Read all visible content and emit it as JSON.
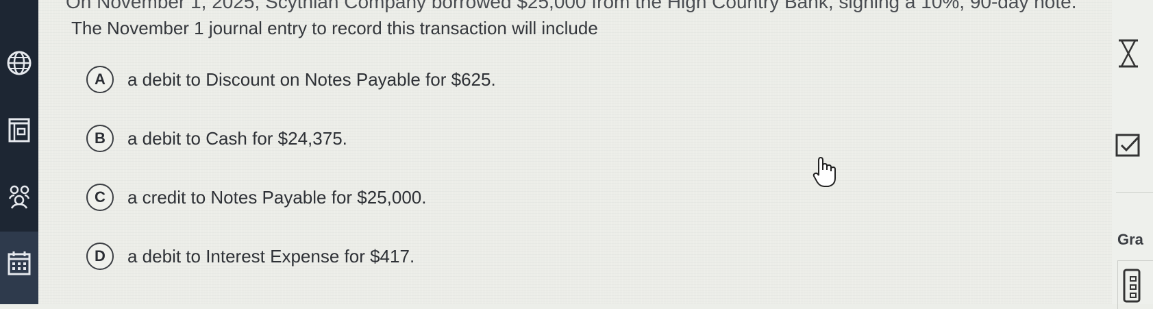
{
  "question": {
    "partial_line": "On November 1, 2025, Scythian Company borrowed $25,000 from the High Country Bank, signing a 10%, 90-day note.",
    "prompt": "The November 1 journal entry to record this transaction will include"
  },
  "options": [
    {
      "letter": "A",
      "text": "a debit to Discount on Notes Payable for $625."
    },
    {
      "letter": "B",
      "text": "a debit to Cash for $24,375."
    },
    {
      "letter": "C",
      "text": "a credit to Notes Payable for $25,000."
    },
    {
      "letter": "D",
      "text": "a debit to Interest Expense for $417."
    }
  ],
  "right_panel": {
    "grade_label": "Gra"
  },
  "icons": {
    "sidebar": [
      "globe-icon",
      "book-icon",
      "group-icon",
      "calendar-icon"
    ],
    "right_panel": [
      "hourglass-icon",
      "checkbox-icon",
      "calculator-icon"
    ],
    "cursor": "hand-pointer-icon"
  },
  "colors": {
    "sidebar_bg": "#1d2633",
    "content_bg": "#ecede8",
    "text": "#2e3136"
  }
}
